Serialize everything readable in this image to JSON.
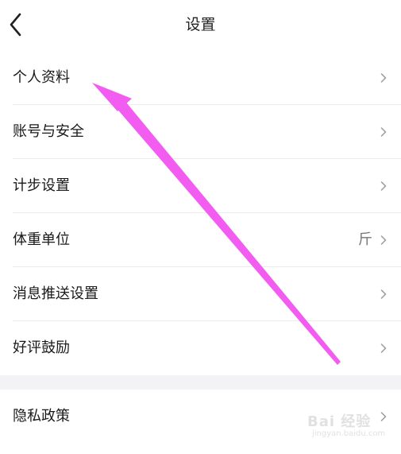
{
  "header": {
    "title": "设置",
    "back_icon": "chevron-left-icon"
  },
  "settings": {
    "group1": [
      {
        "label": "个人资料",
        "value": ""
      },
      {
        "label": "账号与安全",
        "value": ""
      },
      {
        "label": "计步设置",
        "value": ""
      },
      {
        "label": "体重单位",
        "value": "斤"
      },
      {
        "label": "消息推送设置",
        "value": ""
      },
      {
        "label": "好评鼓励",
        "value": ""
      }
    ],
    "group2": [
      {
        "label": "隐私政策",
        "value": ""
      }
    ]
  },
  "annotation": {
    "arrow_color": "#f25cf0"
  },
  "watermark": {
    "text": "Bai 经验",
    "sub": "jingyan.baidu.com"
  },
  "colors": {
    "background": "#ffffff",
    "section_gap": "#f3f3f5",
    "text": "#1a1a1a",
    "chevron": "#9a9a9a"
  }
}
